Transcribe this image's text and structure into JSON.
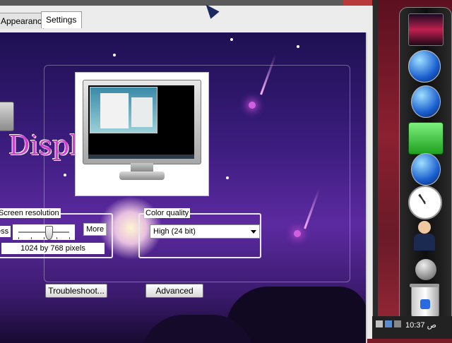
{
  "tabs": [
    {
      "label": "Appearance"
    },
    {
      "label": "Settings"
    }
  ],
  "panel": {
    "title": "Displ"
  },
  "screen_resolution": {
    "legend": "Screen resolution",
    "less_label": "ess",
    "more_label": "More",
    "value": "1024 by 768 pixels",
    "slider_level": 0.6
  },
  "color_quality": {
    "legend": "Color quality",
    "selected": "High (24 bit)"
  },
  "buttons": {
    "troubleshoot": "Troubleshoot...",
    "advanced": "Advanced"
  },
  "taskbar": {
    "clock": "10:37 ص"
  },
  "dock": {
    "items": [
      "wallpaper-icon",
      "network-globe-icon",
      "globe-icon",
      "folder-icon",
      "globe-icon",
      "clock-icon",
      "user-icon",
      "media-icon",
      "recycle-bin-icon"
    ]
  },
  "colors": {
    "accent_title": "#d040d0",
    "panel_background": "#3a1c7c"
  }
}
